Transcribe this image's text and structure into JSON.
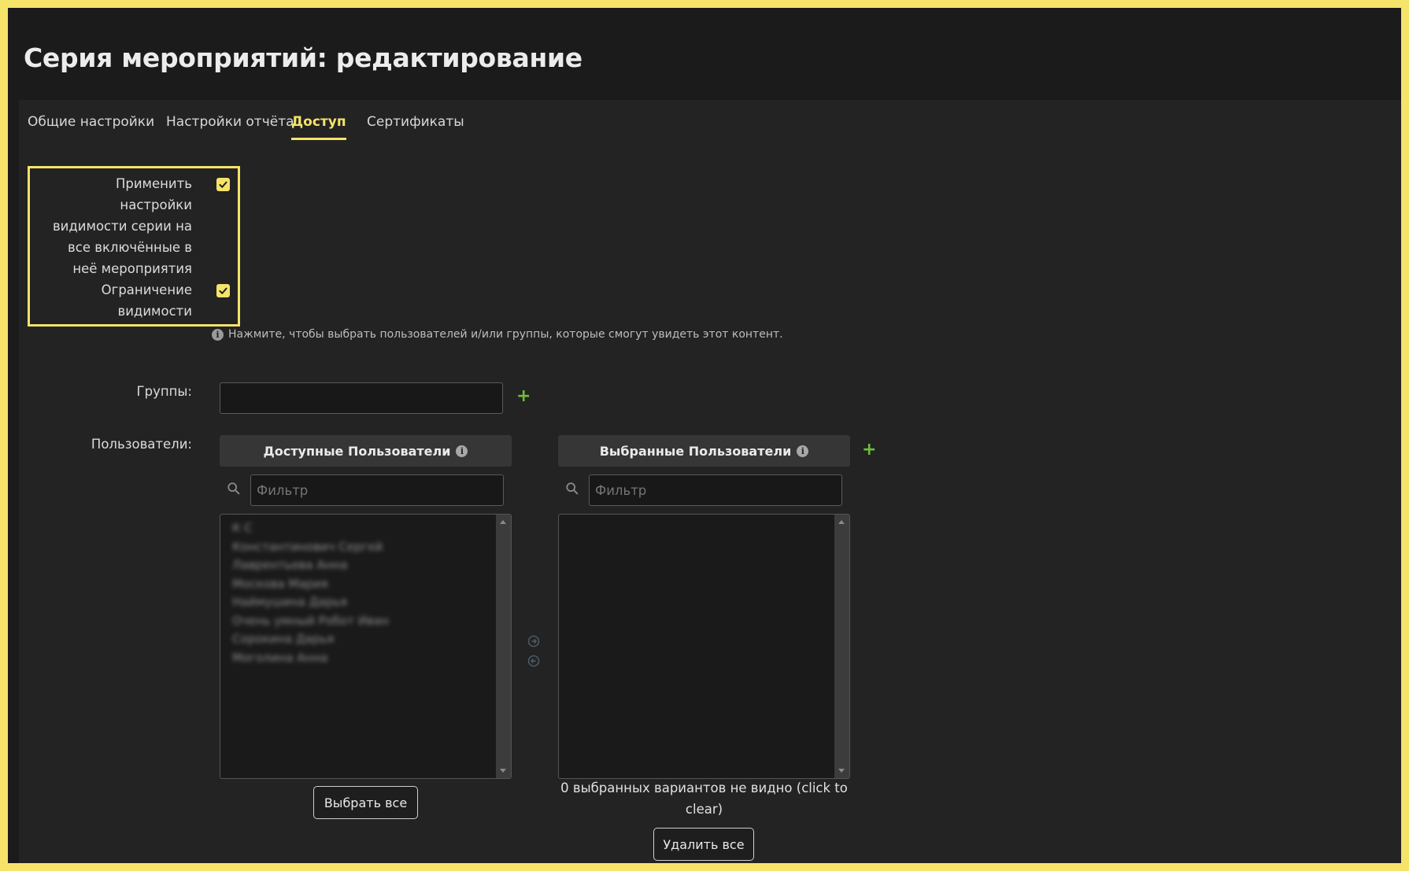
{
  "page": {
    "title": "Серия мероприятий: редактирование"
  },
  "tabs": [
    {
      "label": "Общие настройки",
      "active": false
    },
    {
      "label": "Настройки отчёта",
      "active": false
    },
    {
      "label": "Доступ",
      "active": true
    },
    {
      "label": "Сертификаты",
      "active": false
    }
  ],
  "settings": {
    "apply_series_visibility": {
      "label": "Применить настройки видимости серии на все включённые в неё мероприятия",
      "checked": true
    },
    "restrict_visibility": {
      "label": "Ограничение видимости",
      "checked": true
    },
    "help_text": "Нажмите, чтобы выбрать пользователей и/или группы, которые смогут увидеть этот контент."
  },
  "groups": {
    "label": "Группы:",
    "value": ""
  },
  "users": {
    "label": "Пользователи:",
    "available": {
      "header": "Доступные Пользователи",
      "filter_placeholder": "Фильтр",
      "items": [
        "К С",
        "Константинович Сергей",
        "Лаврентьева Анна",
        "Москова Мария",
        "Наймушина Дарья",
        "Очень умный Робот Иван",
        "Сорокина Дарья",
        "Моголина Анна"
      ],
      "select_all_label": "Выбрать все"
    },
    "selected": {
      "header": "Выбранные Пользователи",
      "filter_placeholder": "Фильтр",
      "items": [],
      "hidden_note": "0 выбранных вариантов не видно (click to clear)",
      "remove_all_label": "Удалить все"
    }
  },
  "colors": {
    "accent": "#f5e36a",
    "add": "#6fbf3a",
    "background": "#1b1b1b"
  }
}
